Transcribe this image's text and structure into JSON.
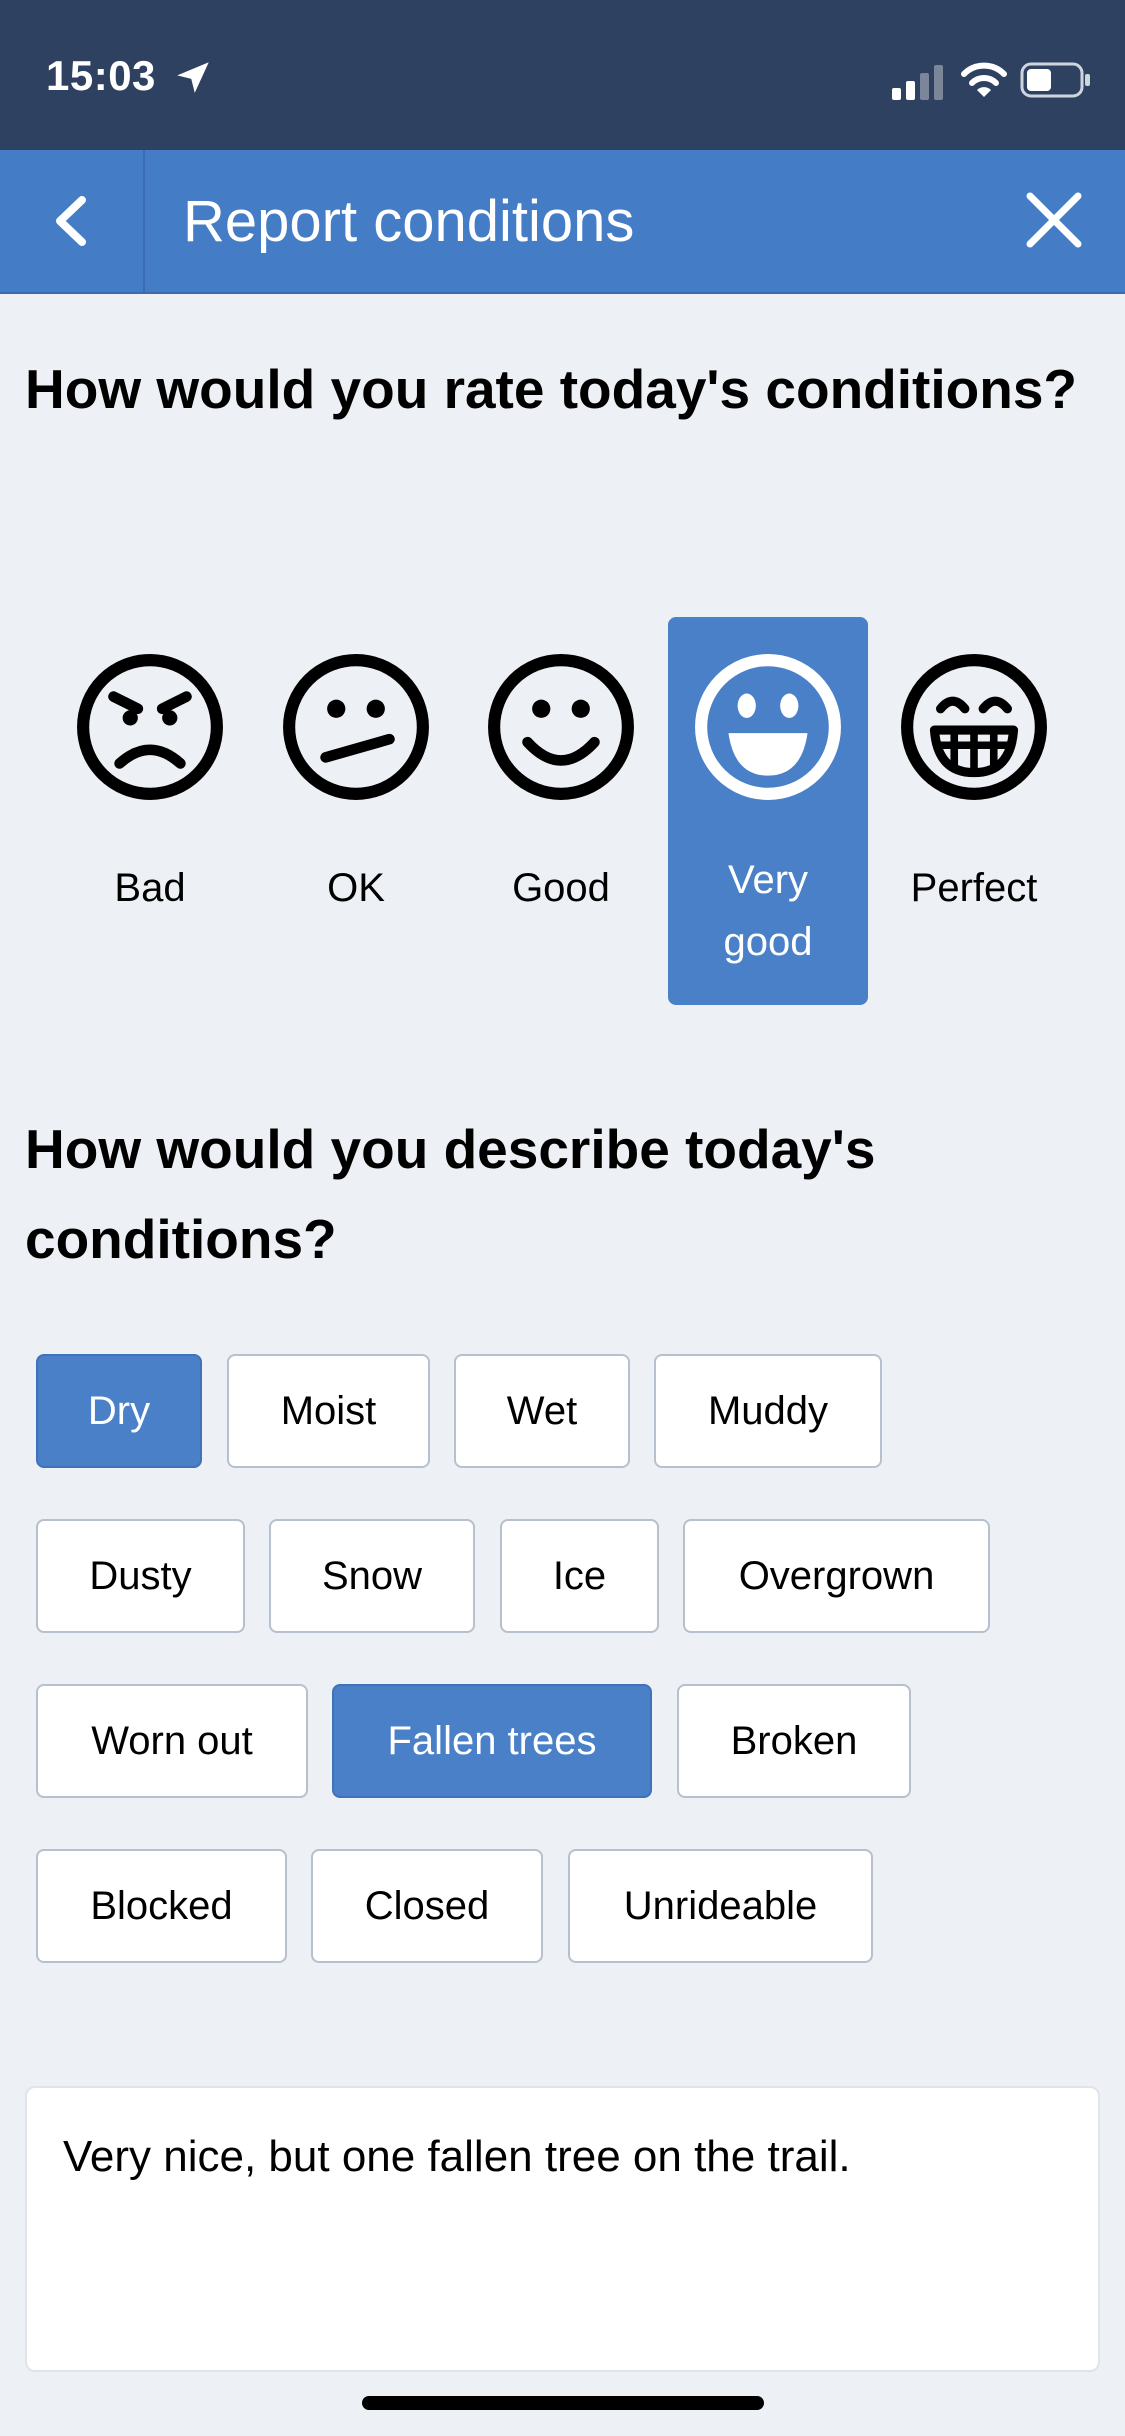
{
  "status_bar": {
    "time": "15:03",
    "icons": [
      "location-arrow-icon",
      "cellular-signal-icon",
      "wifi-icon",
      "battery-icon"
    ]
  },
  "nav": {
    "title": "Report conditions",
    "back_icon": "chevron-left-icon",
    "close_icon": "close-icon"
  },
  "questions": {
    "rate": "How would you rate today's conditions?",
    "describe": "How would you describe today's conditions?"
  },
  "rating": {
    "options": [
      {
        "label": "Bad",
        "icon": "angry-face-icon"
      },
      {
        "label": "OK",
        "icon": "neutral-face-icon"
      },
      {
        "label": "Good",
        "icon": "smile-face-icon"
      },
      {
        "label": "Very good",
        "icon": "big-smile-face-icon"
      },
      {
        "label": "Perfect",
        "icon": "grin-face-icon"
      }
    ],
    "selected": "Very good"
  },
  "conditions": {
    "chips": [
      {
        "label": "Dry",
        "selected": true
      },
      {
        "label": "Moist",
        "selected": false
      },
      {
        "label": "Wet",
        "selected": false
      },
      {
        "label": "Muddy",
        "selected": false
      },
      {
        "label": "Dusty",
        "selected": false
      },
      {
        "label": "Snow",
        "selected": false
      },
      {
        "label": "Ice",
        "selected": false
      },
      {
        "label": "Overgrown",
        "selected": false
      },
      {
        "label": "Worn out",
        "selected": false
      },
      {
        "label": "Fallen trees",
        "selected": true
      },
      {
        "label": "Broken",
        "selected": false
      },
      {
        "label": "Blocked",
        "selected": false
      },
      {
        "label": "Closed",
        "selected": false
      },
      {
        "label": "Unrideable",
        "selected": false
      }
    ]
  },
  "comment": {
    "value": "Very nice, but one fallen tree on the trail."
  },
  "colors": {
    "status_bar": "#2f4161",
    "nav_bar": "#447dc6",
    "accent": "#4a80c8",
    "background": "#edf0f5"
  }
}
